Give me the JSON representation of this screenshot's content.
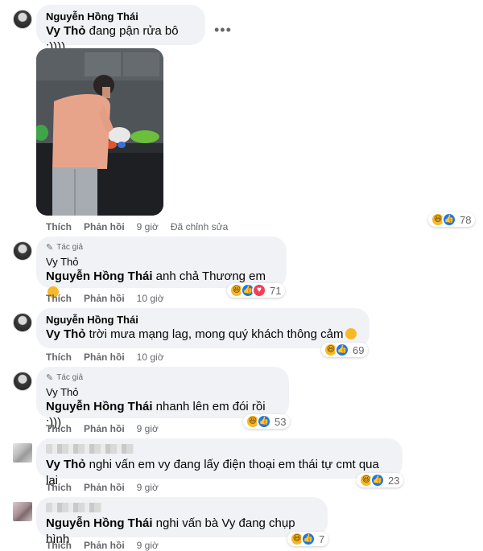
{
  "comments": [
    {
      "author": "Nguyễn Hồng Thái",
      "tag": "Vy Thỏ",
      "text": " đang pận rửa bô :))))",
      "actions": {
        "like": "Thích",
        "reply": "Phản hồi",
        "time": "9 giờ",
        "edited": "Đã chỉnh sửa"
      },
      "reaction_count": "78",
      "reactions": [
        "haha",
        "like"
      ]
    },
    {
      "badge": "Tác giả",
      "author": "Vy Thỏ",
      "tag": "Nguyễn Hồng Thái",
      "text": " anh chả Thương em",
      "actions": {
        "like": "Thích",
        "reply": "Phản hồi",
        "time": "10 giờ"
      },
      "reaction_count": "71",
      "reactions": [
        "haha",
        "like",
        "love"
      ]
    },
    {
      "author": "Nguyễn Hồng Thái",
      "tag": "Vy Thỏ",
      "text": " trời mưa mạng lag, mong quý khách thông cảm",
      "actions": {
        "like": "Thích",
        "reply": "Phản hồi",
        "time": "10 giờ"
      },
      "reaction_count": "69",
      "reactions": [
        "haha",
        "like"
      ]
    },
    {
      "badge": "Tác giả",
      "author": "Vy Thỏ",
      "tag": "Nguyễn Hồng Thái",
      "text": " nhanh lên em đói rồi :)))",
      "actions": {
        "like": "Thích",
        "reply": "Phản hồi",
        "time": "9 giờ"
      },
      "reaction_count": "53",
      "reactions": [
        "haha",
        "like"
      ]
    },
    {
      "tag": "Vy Thỏ",
      "text": " nghi vấn em vy đang lấy điện thoại em thái tự cmt qua lại",
      "actions": {
        "like": "Thích",
        "reply": "Phản hồi",
        "time": "9 giờ"
      },
      "reaction_count": "23",
      "reactions": [
        "haha",
        "like"
      ]
    },
    {
      "tag": "Nguyễn Hồng Thái",
      "text": " nghi vấn bà Vy đang chụp hình",
      "actions": {
        "like": "Thích",
        "reply": "Phản hồi",
        "time": "9 giờ"
      },
      "reaction_count": "7",
      "reactions": [
        "haha",
        "like"
      ]
    }
  ],
  "more_options_glyph": "•••",
  "icons": {
    "haha": "haha-reaction-icon",
    "like": "like-reaction-icon",
    "love": "love-reaction-icon",
    "pen": "pencil-icon"
  }
}
